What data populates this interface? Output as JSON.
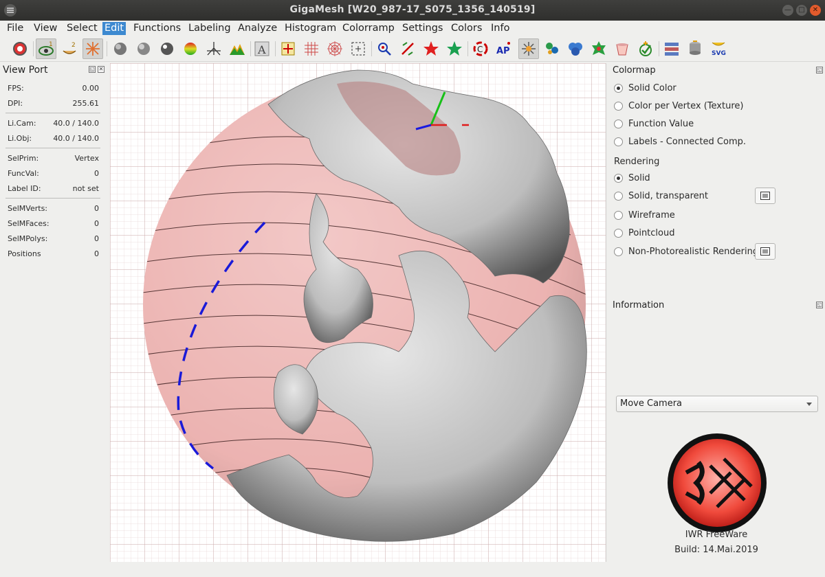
{
  "window": {
    "title": "GigaMesh [W20_987-17_S075_1356_140519]"
  },
  "menubar": {
    "items": [
      "File",
      "View",
      "Select",
      "Edit",
      "Functions",
      "Labeling",
      "Analyze",
      "Histogram",
      "Colorramp",
      "Settings",
      "Colors",
      "Info"
    ],
    "active": "Edit"
  },
  "toolbar": {
    "buttons": [
      "screenshot-icon",
      "view-mode-1-icon",
      "view-mode-2-icon",
      "view-mode-3-icon",
      "sphere-shading-m-icon",
      "sphere-shading-d-icon",
      "sphere-shading-s-icon",
      "color-sphere-a-icon",
      "axes-icon",
      "mountains-icon",
      "text-label-icon",
      "crosshair-icon",
      "grid-icon",
      "polar-grid-icon",
      "frame-icon",
      "select-tool-icon",
      "no-selection-icon",
      "red-star-icon",
      "green-star-icon",
      "color-gradient-icon",
      "ap-icon",
      "light-icon",
      "cluster-icon",
      "bubbles-icon",
      "green-blob-icon",
      "bucket-icon",
      "check-icon",
      "layers-icon",
      "cylinder-icon",
      "svg-export-icon"
    ]
  },
  "viewport": {
    "title": "View Port",
    "rows": [
      {
        "key": "FPS:",
        "value": "0.00"
      },
      {
        "key": "DPI:",
        "value": "255.61"
      },
      {
        "key": "Li.Cam:",
        "value": "40.0 / 140.0"
      },
      {
        "key": "Li.Obj:",
        "value": "40.0 / 140.0"
      },
      {
        "key": "SelPrim:",
        "value": "Vertex"
      },
      {
        "key": "FuncVal:",
        "value": "0"
      },
      {
        "key": "Label ID:",
        "value": "not set"
      },
      {
        "key": "SelMVerts:",
        "value": "0"
      },
      {
        "key": "SelMFaces:",
        "value": "0"
      },
      {
        "key": "SelMPolys:",
        "value": "0"
      },
      {
        "key": "Positions",
        "value": "0"
      }
    ]
  },
  "colormap": {
    "title": "Colormap",
    "options": [
      "Solid Color",
      "Color per Vertex (Texture)",
      "Function Value",
      "Labels - Connected Comp."
    ],
    "selected": 0
  },
  "rendering": {
    "title": "Rendering",
    "options": [
      "Solid",
      "Solid, transparent",
      "Wireframe",
      "Pointcloud",
      "Non-Photorealistic Rendering"
    ],
    "selected": 0
  },
  "information": {
    "title": "Information"
  },
  "mode_select": {
    "value": "Move Camera"
  },
  "about": {
    "license": "IWR FreeWare",
    "build": "Build: 14.Mai.2019"
  },
  "colors": {
    "menu_active": "#3d89d0",
    "sphere_tint": "#f2a8a5",
    "mesh_grey": "#c4c4c4",
    "close_button": "#e25b2c"
  }
}
